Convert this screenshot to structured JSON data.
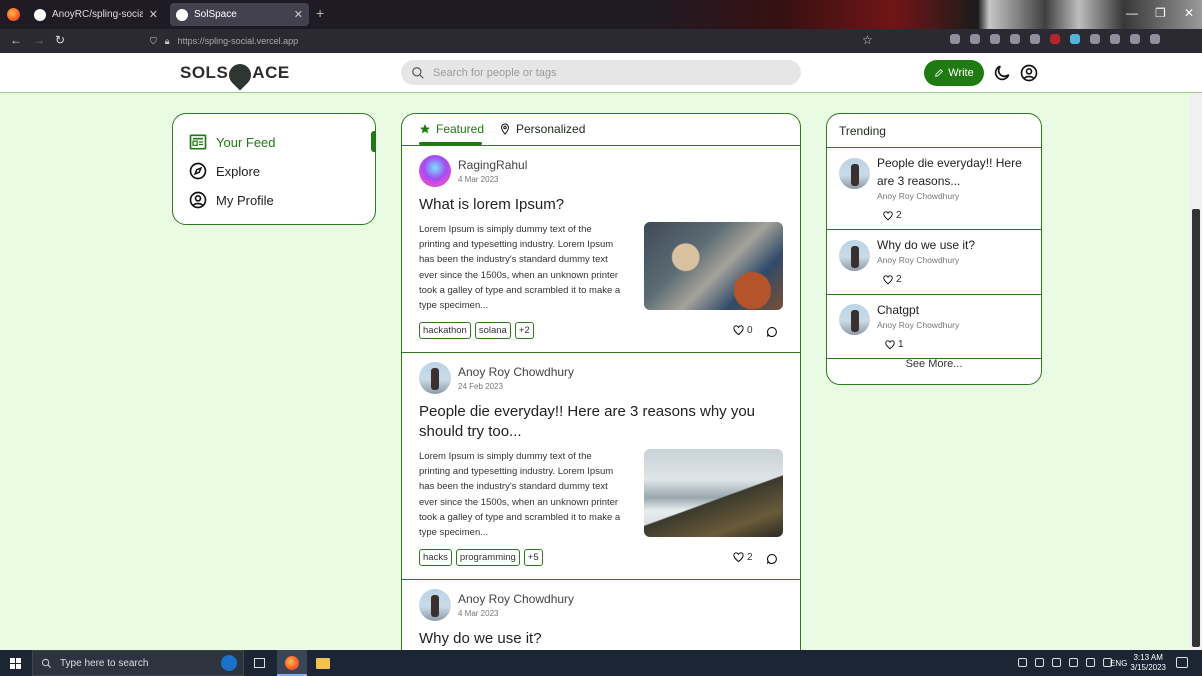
{
  "browser": {
    "tabs": [
      {
        "title": "AnoyRC/spling-social: SolSpace"
      },
      {
        "title": "SolSpace"
      }
    ],
    "url": "https://spling-social.vercel.app"
  },
  "header": {
    "logo_left": "SOLS",
    "logo_right": "ACE",
    "search_placeholder": "Search for people or tags",
    "write_label": "Write"
  },
  "sidebar": {
    "items": [
      {
        "label": "Your Feed",
        "icon": "newspaper-icon",
        "active": true
      },
      {
        "label": "Explore",
        "icon": "compass-icon",
        "active": false
      },
      {
        "label": "My Profile",
        "icon": "user-circle-icon",
        "active": false
      }
    ]
  },
  "feed": {
    "tabs": [
      {
        "label": "Featured",
        "icon": "star-icon",
        "active": true
      },
      {
        "label": "Personalized",
        "icon": "location-pin-icon",
        "active": false
      }
    ],
    "posts": [
      {
        "author": "RagingRahul",
        "date": "4 Mar 2023",
        "title": "What is lorem Ipsum?",
        "excerpt": "Lorem Ipsum is simply dummy text of the printing and typesetting industry. Lorem Ipsum has been the industry's standard dummy text ever since the 1500s, when an unknown printer took a galley of type and scrambled it to make a type specimen...",
        "tags": [
          "hackathon",
          "solana",
          "+2"
        ],
        "likes": "0"
      },
      {
        "author": "Anoy Roy Chowdhury",
        "date": "24 Feb 2023",
        "title": "People die everyday!! Here are 3 reasons why you should try too...",
        "excerpt": "Lorem Ipsum is simply dummy text of the printing and typesetting industry. Lorem Ipsum has been the industry's standard dummy text ever since the 1500s, when an unknown printer took a galley of type and scrambled it to make a type specimen...",
        "tags": [
          "hacks",
          "programming",
          "+5"
        ],
        "likes": "2"
      },
      {
        "author": "Anoy Roy Chowdhury",
        "date": "4 Mar 2023",
        "title": "Why do we use it?"
      }
    ]
  },
  "trending": {
    "heading": "Trending",
    "items": [
      {
        "title": "People die everyday!! Here are 3 reasons...",
        "author": "Anoy Roy Chowdhury",
        "likes": "2"
      },
      {
        "title": "Why do we use it?",
        "author": "Anoy Roy Chowdhury",
        "likes": "2"
      },
      {
        "title": "Chatgpt",
        "author": "Anoy Roy Chowdhury",
        "likes": "1"
      }
    ],
    "see_more": "See More..."
  },
  "taskbar": {
    "search_placeholder": "Type here to search",
    "lang": "ENG",
    "time": "3:13 AM",
    "date": "3/15/2023"
  },
  "colors": {
    "accent": "#1f7a12",
    "page_bg": "#e9fbe2",
    "border": "#2f7a1f"
  }
}
